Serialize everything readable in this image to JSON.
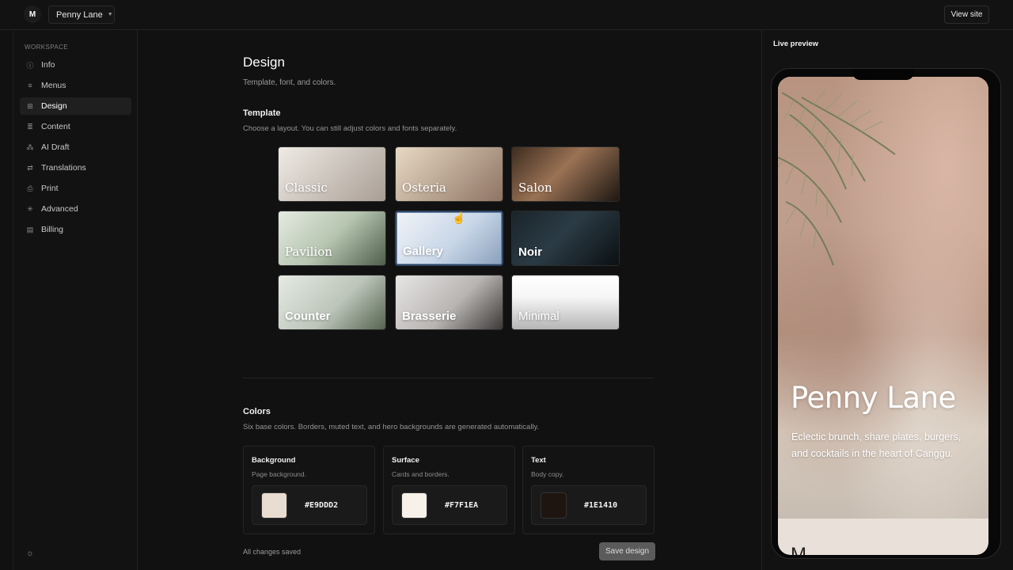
{
  "topbar": {
    "logo": "M",
    "project": "Penny Lane",
    "view_site": "View site"
  },
  "sidebar": {
    "section": "WORKSPACE",
    "items": [
      {
        "label": "Info",
        "icon": "info-icon"
      },
      {
        "label": "Menus",
        "icon": "menu-icon"
      },
      {
        "label": "Design",
        "icon": "grid-icon",
        "active": true
      },
      {
        "label": "Content",
        "icon": "content-icon"
      },
      {
        "label": "AI Draft",
        "icon": "ai-icon"
      },
      {
        "label": "Translations",
        "icon": "translate-icon"
      },
      {
        "label": "Print",
        "icon": "print-icon"
      },
      {
        "label": "Advanced",
        "icon": "gear-icon"
      },
      {
        "label": "Billing",
        "icon": "billing-icon"
      }
    ],
    "theme_icon": "sun-icon"
  },
  "main": {
    "title": "Design",
    "subtitle": "Template, font, and colors.",
    "template": {
      "title": "Template",
      "hint": "Choose a layout. You can still adjust colors and fonts separately.",
      "items": [
        {
          "name": "Classic"
        },
        {
          "name": "Osteria"
        },
        {
          "name": "Salon"
        },
        {
          "name": "Pavilion"
        },
        {
          "name": "Gallery",
          "selected": true
        },
        {
          "name": "Noir"
        },
        {
          "name": "Counter"
        },
        {
          "name": "Brasserie"
        },
        {
          "name": "Minimal"
        }
      ]
    },
    "colors": {
      "title": "Colors",
      "hint": "Six base colors. Borders, muted text, and hero backgrounds are generated automatically.",
      "items": [
        {
          "title": "Background",
          "sub": "Page background.",
          "hex": "#E9DDD2"
        },
        {
          "title": "Surface",
          "sub": "Cards and borders.",
          "hex": "#F7F1EA"
        },
        {
          "title": "Text",
          "sub": "Body copy.",
          "hex": "#1E1410"
        }
      ]
    },
    "status": "All changes saved",
    "save_label": "Save design"
  },
  "preview": {
    "label": "Live preview",
    "hero_title": "Penny Lane",
    "hero_subtitle": "Eclectic brunch, share plates, burgers, and cocktails in the heart of Canggu.",
    "menu_peek": "M"
  }
}
